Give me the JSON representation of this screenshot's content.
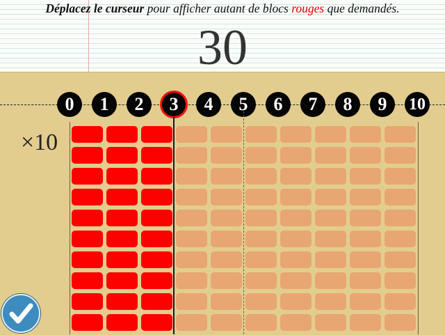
{
  "instruction": {
    "part_bold": "Déplacez le curseur",
    "part_1": " pour afficher autant de blocs ",
    "part_red": "rouges",
    "part_2": " que demandés."
  },
  "target_number": "30",
  "multiplier_label": "×10",
  "ruler": {
    "ticks": [
      "0",
      "1",
      "2",
      "3",
      "4",
      "5",
      "6",
      "7",
      "8",
      "9",
      "10"
    ],
    "selected_value": 3
  },
  "grid": {
    "columns": 10,
    "rows": 10,
    "filled_columns": 3
  },
  "colors": {
    "filled": "#ff0000",
    "empty": "#e8a673",
    "selection_ring": "#ff1010"
  },
  "validate_button": {
    "icon": "checkmark-icon"
  }
}
